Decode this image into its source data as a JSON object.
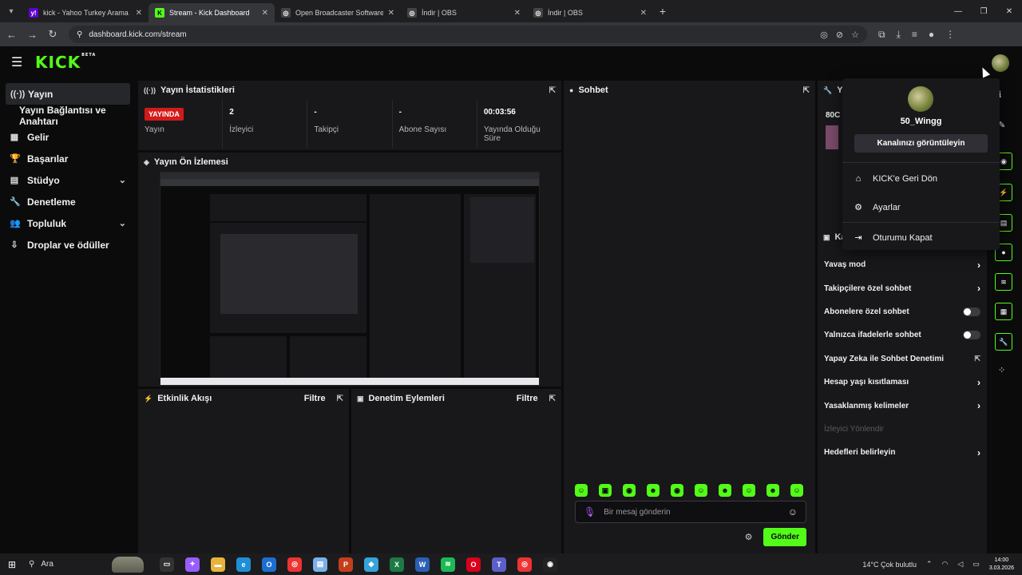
{
  "browser": {
    "tabs": [
      {
        "label": "kick - Yahoo Turkey Arama Son",
        "fav": "y!",
        "fav_color": "#6001d2",
        "active": false
      },
      {
        "label": "Stream - Kick Dashboard",
        "fav": "K",
        "fav_color": "#53fc18",
        "active": true
      },
      {
        "label": "Open Broadcaster Software | O",
        "fav": "◎",
        "fav_color": "#444",
        "active": false
      },
      {
        "label": "İndir | OBS",
        "fav": "◎",
        "fav_color": "#444",
        "active": false
      },
      {
        "label": "İndir | OBS",
        "fav": "◎",
        "fav_color": "#444",
        "active": false
      }
    ],
    "url": "dashboard.kick.com/stream"
  },
  "kick": {
    "brand": "KICK",
    "beta": "BETA",
    "brand_color": "#53fc18"
  },
  "sidebar": {
    "items": [
      {
        "label": "Yayın",
        "icon": "broadcast-icon",
        "glyph": "((·))",
        "active": true,
        "chevron": false,
        "sub": false
      },
      {
        "label": "Yayın Bağlantısı ve Anahtarı",
        "icon": "",
        "glyph": "",
        "active": false,
        "chevron": false,
        "sub": true
      },
      {
        "label": "Gelir",
        "icon": "chart-icon",
        "glyph": "▦",
        "active": false,
        "chevron": false,
        "sub": false
      },
      {
        "label": "Başarılar",
        "icon": "trophy-icon",
        "glyph": "🏆",
        "active": false,
        "chevron": false,
        "sub": false
      },
      {
        "label": "Stüdyo",
        "icon": "studio-icon",
        "glyph": "▤",
        "active": false,
        "chevron": true,
        "sub": false
      },
      {
        "label": "Denetleme",
        "icon": "wrench-icon",
        "glyph": "🔧",
        "active": false,
        "chevron": false,
        "sub": false
      },
      {
        "label": "Topluluk",
        "icon": "community-icon",
        "glyph": "👥",
        "active": false,
        "chevron": true,
        "sub": false
      },
      {
        "label": "Droplar ve ödüller",
        "icon": "drops-icon",
        "glyph": "⇩",
        "active": false,
        "chevron": false,
        "sub": false
      }
    ]
  },
  "stats_panel": {
    "title": "Yayın İstatistikleri",
    "live_badge": "YAYINDA",
    "stats": [
      {
        "value": "",
        "label": "Yayın"
      },
      {
        "value": "2",
        "label": "İzleyici"
      },
      {
        "value": "-",
        "label": "Takipçi"
      },
      {
        "value": "-",
        "label": "Abone Sayısı"
      },
      {
        "value": "00:03:56",
        "label": "Yayında Olduğu Süre"
      }
    ]
  },
  "preview_panel": {
    "title": "Yayın Ön İzlemesi"
  },
  "activity_panel": {
    "title": "Etkinlik Akışı",
    "filter": "Filtre"
  },
  "moderation_panel": {
    "title": "Denetim Eylemleri",
    "filter": "Filtre"
  },
  "chat_panel": {
    "title": "Sohbet",
    "input_placeholder": "Bir mesaj gönderin",
    "send_label": "Gönder",
    "emojis": [
      "☺",
      "▣",
      "◉",
      "☻",
      "◉",
      "☺",
      "☻",
      "☺",
      "☻",
      "☺"
    ]
  },
  "right_panel": {
    "head_partial": "Ya",
    "code_partial": "80C",
    "chat_head_partial": "Ka",
    "settings": [
      {
        "label": "Yavaş mod",
        "control": "chevron"
      },
      {
        "label": "Takipçilere özel sohbet",
        "control": "chevron"
      },
      {
        "label": "Abonelere özel sohbet",
        "control": "toggle"
      },
      {
        "label": "Yalnızca ifadelerle sohbet",
        "control": "toggle"
      },
      {
        "label": "Yapay Zeka ile Sohbet Denetimi",
        "control": "external"
      },
      {
        "label": "Hesap yaşı kısıtlaması",
        "control": "chevron"
      },
      {
        "label": "Yasaklanmış kelimeler",
        "control": "chevron"
      },
      {
        "label": "İzleyici Yönlendir",
        "control": "muted"
      },
      {
        "label": "Hedefleri belirleyin",
        "control": "chevron"
      }
    ]
  },
  "user_menu": {
    "username": "50_Wingg",
    "view_channel": "Kanalınızı görüntüleyin",
    "items": [
      {
        "label": "KICK'e Geri Dön",
        "icon": "home-icon",
        "glyph": "⌂"
      },
      {
        "label": "Ayarlar",
        "icon": "gear-icon",
        "glyph": "⚙"
      },
      {
        "label": "Oturumu Kapat",
        "icon": "logout-icon",
        "glyph": "⇥"
      }
    ]
  },
  "taskbar": {
    "search_label": "Ara",
    "weather": "14°C  Çok bulutlu",
    "time": "14:00",
    "date": "3.03.2026"
  }
}
